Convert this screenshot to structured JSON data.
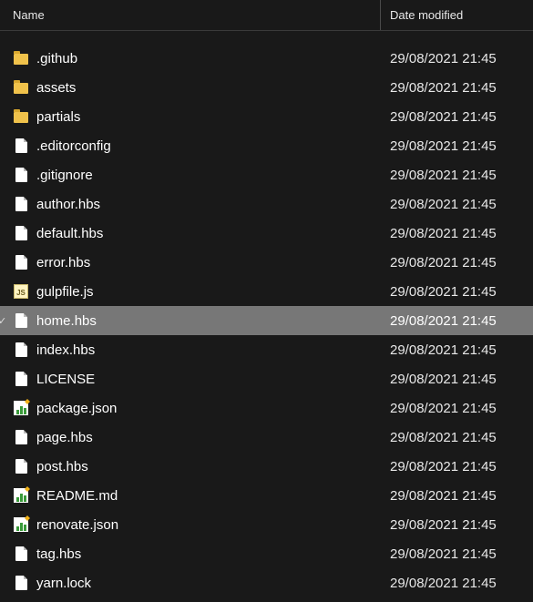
{
  "columns": {
    "name": "Name",
    "date": "Date modified"
  },
  "files": [
    {
      "name": ".github",
      "date": "29/08/2021 21:45",
      "icon": "folder",
      "selected": false
    },
    {
      "name": "assets",
      "date": "29/08/2021 21:45",
      "icon": "folder",
      "selected": false
    },
    {
      "name": "partials",
      "date": "29/08/2021 21:45",
      "icon": "folder",
      "selected": false
    },
    {
      "name": ".editorconfig",
      "date": "29/08/2021 21:45",
      "icon": "file",
      "selected": false
    },
    {
      "name": ".gitignore",
      "date": "29/08/2021 21:45",
      "icon": "file",
      "selected": false
    },
    {
      "name": "author.hbs",
      "date": "29/08/2021 21:45",
      "icon": "file",
      "selected": false
    },
    {
      "name": "default.hbs",
      "date": "29/08/2021 21:45",
      "icon": "file",
      "selected": false
    },
    {
      "name": "error.hbs",
      "date": "29/08/2021 21:45",
      "icon": "file",
      "selected": false
    },
    {
      "name": "gulpfile.js",
      "date": "29/08/2021 21:45",
      "icon": "js",
      "selected": false
    },
    {
      "name": "home.hbs",
      "date": "29/08/2021 21:45",
      "icon": "file",
      "selected": true
    },
    {
      "name": "index.hbs",
      "date": "29/08/2021 21:45",
      "icon": "file",
      "selected": false
    },
    {
      "name": "LICENSE",
      "date": "29/08/2021 21:45",
      "icon": "file",
      "selected": false
    },
    {
      "name": "package.json",
      "date": "29/08/2021 21:45",
      "icon": "chart",
      "selected": false
    },
    {
      "name": "page.hbs",
      "date": "29/08/2021 21:45",
      "icon": "file",
      "selected": false
    },
    {
      "name": "post.hbs",
      "date": "29/08/2021 21:45",
      "icon": "file",
      "selected": false
    },
    {
      "name": "README.md",
      "date": "29/08/2021 21:45",
      "icon": "chart",
      "selected": false
    },
    {
      "name": "renovate.json",
      "date": "29/08/2021 21:45",
      "icon": "chart",
      "selected": false
    },
    {
      "name": "tag.hbs",
      "date": "29/08/2021 21:45",
      "icon": "file",
      "selected": false
    },
    {
      "name": "yarn.lock",
      "date": "29/08/2021 21:45",
      "icon": "file",
      "selected": false
    }
  ]
}
